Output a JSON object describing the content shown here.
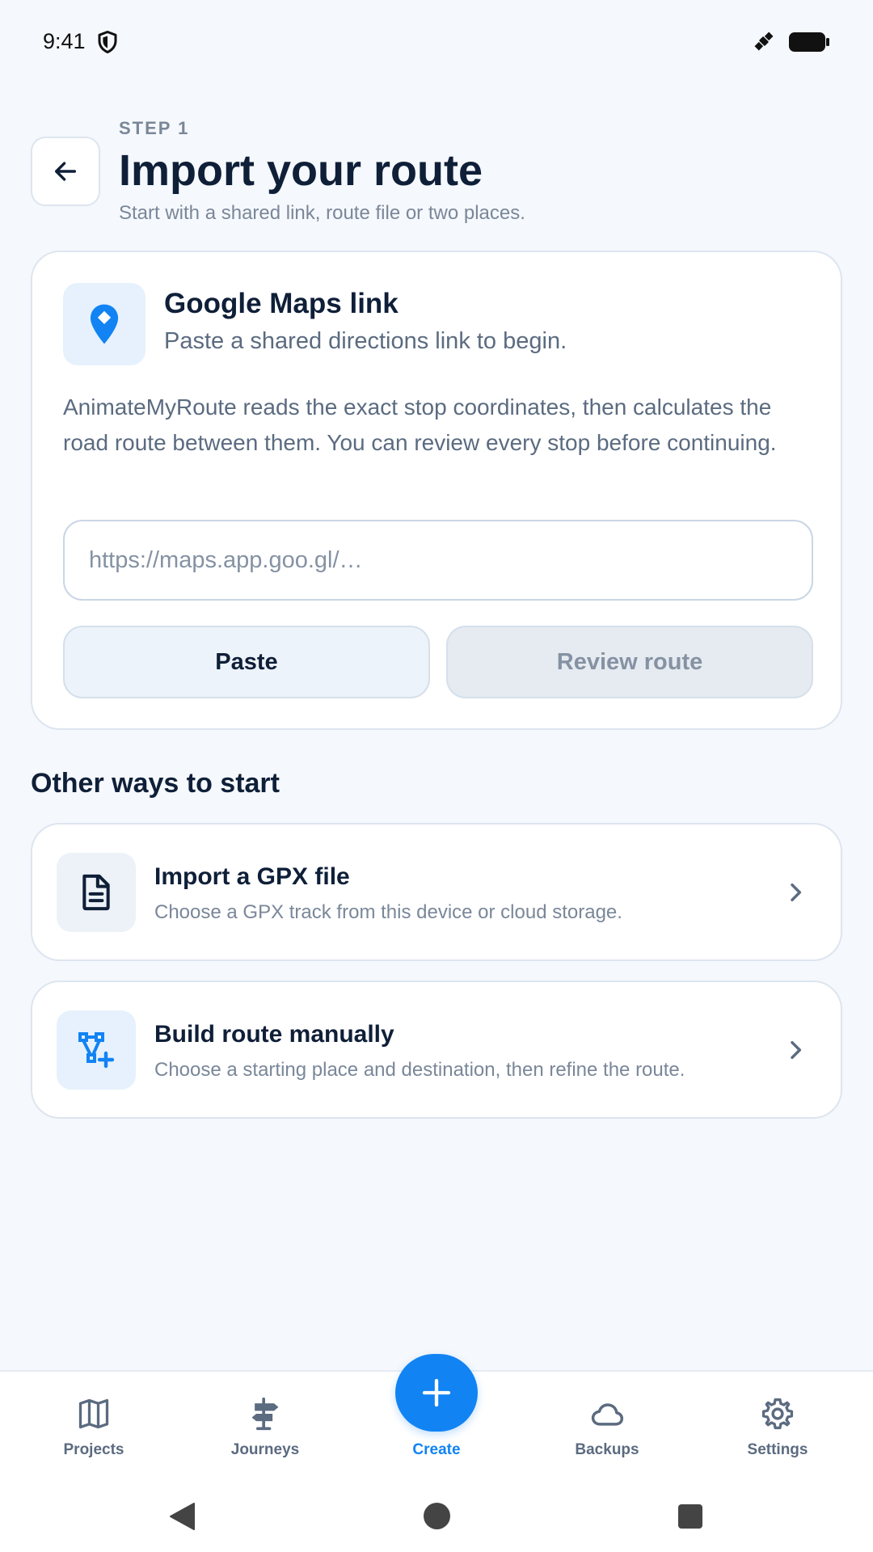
{
  "status_bar": {
    "time": "9:41",
    "icons": [
      "shield-icon",
      "satellite-icon",
      "battery-icon"
    ]
  },
  "header": {
    "step": "STEP 1",
    "title": "Import your route",
    "subtitle": "Start with a shared link, route file or two places."
  },
  "maps_card": {
    "icon": "map-pin-icon",
    "title": "Google Maps link",
    "subtitle": "Paste a shared directions link to begin.",
    "description": "AnimateMyRoute reads the exact stop coordinates, then calculates the road route between them. You can review every stop before continuing.",
    "input_value": "",
    "input_placeholder": "https://maps.app.goo.gl/…",
    "paste_label": "Paste",
    "review_label": "Review route"
  },
  "other_ways": {
    "heading": "Other ways to start",
    "options": [
      {
        "icon": "document-icon",
        "title": "Import a GPX file",
        "description": "Choose a GPX track from this device or cloud storage."
      },
      {
        "icon": "route-add-icon",
        "title": "Build route manually",
        "description": "Choose a starting place and destination, then refine the route."
      }
    ]
  },
  "bottom_nav": {
    "items": [
      {
        "label": "Projects",
        "icon": "map-icon"
      },
      {
        "label": "Journeys",
        "icon": "signpost-icon"
      },
      {
        "label": "Create",
        "icon": "plus-icon",
        "active": true
      },
      {
        "label": "Backups",
        "icon": "cloud-icon"
      },
      {
        "label": "Settings",
        "icon": "gear-icon"
      }
    ]
  },
  "colors": {
    "accent": "#1283f3",
    "background": "#f5f8fc",
    "text_primary": "#0f1f38",
    "text_secondary": "#7a8799"
  }
}
